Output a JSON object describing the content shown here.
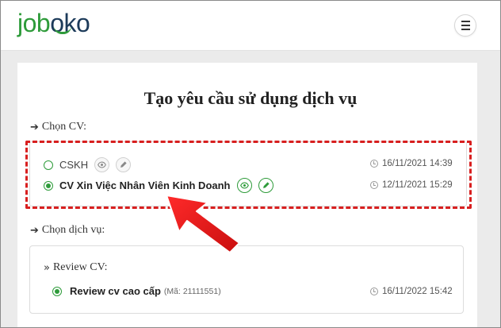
{
  "brand": {
    "logo_part1": "job",
    "logo_part2": "ok",
    "logo_part3": "o"
  },
  "header": {
    "menu_icon": "hamburger-icon"
  },
  "page": {
    "title": "Tạo yêu cầu sử dụng dịch vụ"
  },
  "cv_section": {
    "label": "Chọn CV:",
    "items": [
      {
        "name": "CSKH",
        "selected": false,
        "date": "16/11/2021 14:39",
        "icons": [
          "eye-icon",
          "pencil-icon"
        ]
      },
      {
        "name": "CV Xin Việc Nhân Viên Kinh Doanh",
        "selected": true,
        "date": "12/11/2021 15:29",
        "icons": [
          "eye-icon",
          "pencil-icon"
        ]
      }
    ]
  },
  "service_section": {
    "label": "Chọn dịch vụ:",
    "group_label": "Review CV:",
    "item": {
      "name": "Review cv cao cấp",
      "code": "(Mã: 21111551)",
      "date": "16/11/2022 15:42",
      "selected": true
    }
  },
  "colors": {
    "brand_green": "#2e9b3a",
    "brand_navy": "#1d3b5a",
    "annotation_red": "#d81f1f"
  }
}
